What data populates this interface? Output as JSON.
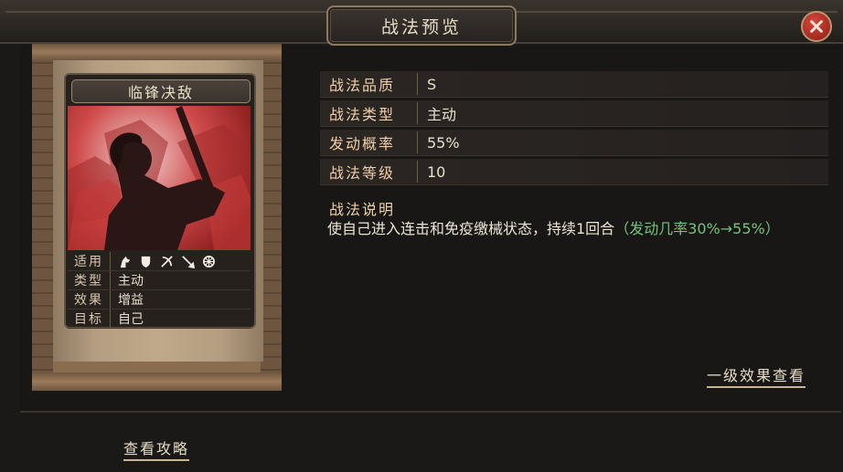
{
  "window": {
    "title": "战法预览"
  },
  "card": {
    "name": "临锋决敌",
    "stats": [
      {
        "label": "适用",
        "icons": [
          "cavalry-icon",
          "shield-icon",
          "bow-icon",
          "spear-icon",
          "siege-icon"
        ]
      },
      {
        "label": "类型",
        "value": "主动"
      },
      {
        "label": "效果",
        "value": "增益"
      },
      {
        "label": "目标",
        "value": "自己"
      }
    ]
  },
  "info": {
    "rows": [
      {
        "label": "战法品质",
        "value": "S"
      },
      {
        "label": "战法类型",
        "value": "主动"
      },
      {
        "label": "发动概率",
        "value": "55%"
      },
      {
        "label": "战法等级",
        "value": "10"
      }
    ],
    "desc_title": "战法说明",
    "desc_main": "使自己进入连击和免疫缴械状态，持续1回合",
    "desc_green": "（发动几率30%→55%）"
  },
  "links": {
    "level_effect": "一级效果查看",
    "strategy": "查看攻略"
  },
  "colors": {
    "label_orange": "#f0cfaa",
    "green": "#72c47a",
    "close_red": "#c0392b"
  }
}
